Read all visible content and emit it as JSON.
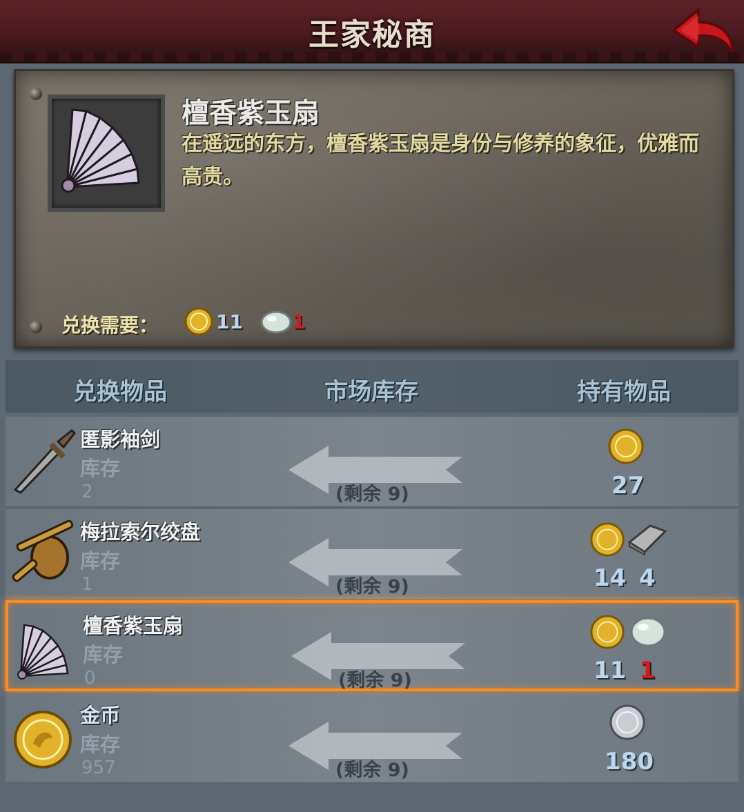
{
  "header": {
    "title": "王家秘商"
  },
  "detail": {
    "name": "檀香紫玉扇",
    "description": "在遥远的东方，檀香紫玉扇是身份与修养的象征，优雅而高贵。",
    "requirement_label": "兑换需要：",
    "cost_gold": "11",
    "cost_gem": "1"
  },
  "columns": {
    "exchange": "兑换物品",
    "market": "市场库存",
    "owned": "持有物品"
  },
  "rows": [
    {
      "name": "匿影袖剑",
      "stock_label": "库存",
      "stock": "2",
      "remain": "(剩余 9)",
      "icon": "dagger-icon",
      "cost": [
        "27"
      ]
    },
    {
      "name": "梅拉索尔绞盘",
      "stock_label": "库存",
      "stock": "1",
      "remain": "(剩余 9)",
      "icon": "winch-icon",
      "cost": [
        "14",
        "4"
      ]
    },
    {
      "name": "檀香紫玉扇",
      "stock_label": "库存",
      "stock": "0",
      "remain": "(剩余 9)",
      "icon": "fan-icon",
      "cost": [
        "11",
        "1"
      ]
    },
    {
      "name": "金币",
      "stock_label": "库存",
      "stock": "957",
      "remain": "(剩余 9)",
      "icon": "gold-coin-icon",
      "cost": [
        "180"
      ]
    }
  ],
  "colors": {
    "selected_border": "#ff8a1f",
    "insufficient": "#d41a1a",
    "title_bg": "#4a1a1f"
  }
}
